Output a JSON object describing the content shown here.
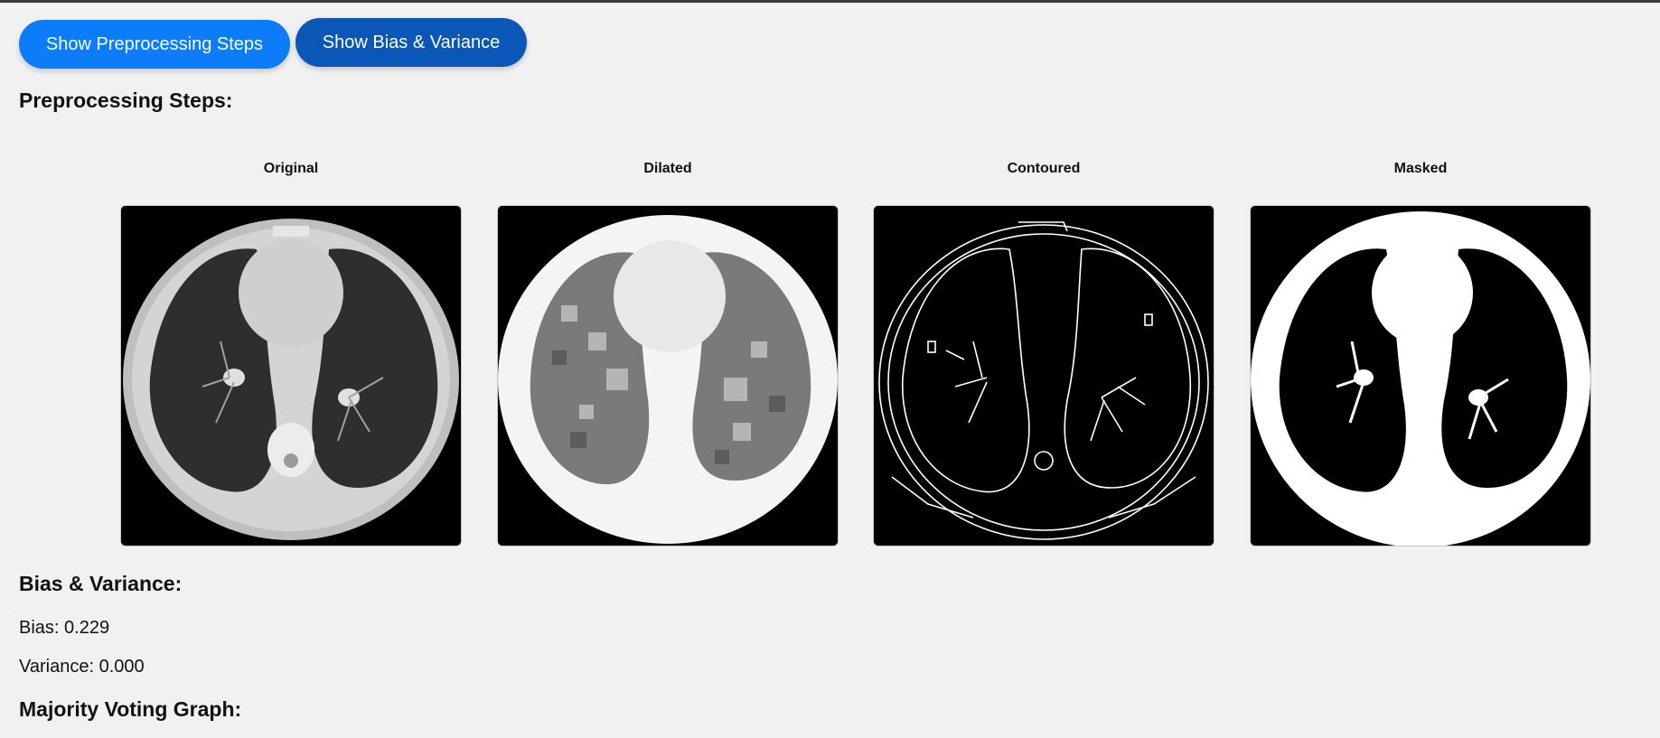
{
  "toolbar": {
    "preprocessing_button": "Show Preprocessing Steps",
    "bias_variance_button": "Show Bias & Variance"
  },
  "preprocessing": {
    "title": "Preprocessing Steps:",
    "steps": [
      {
        "label": "Original",
        "icon": "ct-scan-original-image"
      },
      {
        "label": "Dilated",
        "icon": "ct-scan-dilated-image"
      },
      {
        "label": "Contoured",
        "icon": "ct-scan-contoured-image"
      },
      {
        "label": "Masked",
        "icon": "ct-scan-masked-image"
      }
    ]
  },
  "bias_variance": {
    "title": "Bias & Variance:",
    "bias": "Bias: 0.229",
    "variance": "Variance: 0.000"
  },
  "majority_voting": {
    "title": "Majority Voting Graph:"
  },
  "colors": {
    "primary_button": "#0b7dfa",
    "secondary_button": "#0a57b8",
    "background": "#f1f1f1"
  }
}
